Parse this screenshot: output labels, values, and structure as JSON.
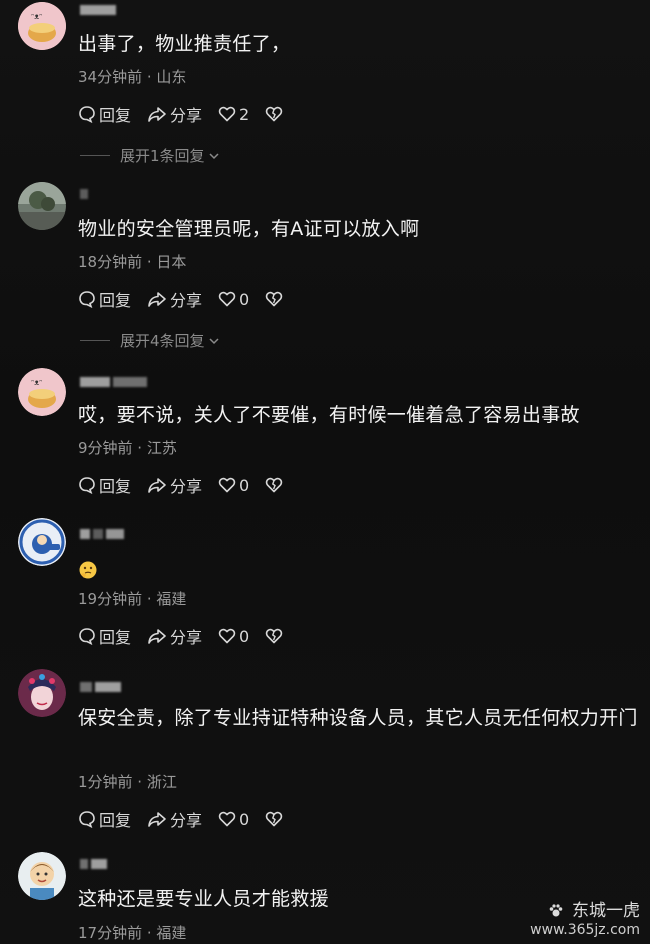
{
  "comments": [
    {
      "text": "出事了，物业推责任了，",
      "meta": "34分钟前 · 山东",
      "reply_label": "回复",
      "share_label": "分享",
      "like_count": "2",
      "expand_label": "展开1条回复"
    },
    {
      "text": "物业的安全管理员呢，有A证可以放入啊",
      "meta": "18分钟前 · 日本",
      "reply_label": "回复",
      "share_label": "分享",
      "like_count": "0",
      "expand_label": "展开4条回复"
    },
    {
      "text": "哎，要不说，关人了不要催，有时候一催着急了容易出事故",
      "meta": "9分钟前 · 江苏",
      "reply_label": "回复",
      "share_label": "分享",
      "like_count": "0"
    },
    {
      "text": "",
      "emoji": "thinking-face-emoji",
      "meta": "19分钟前 · 福建",
      "reply_label": "回复",
      "share_label": "分享",
      "like_count": "0"
    },
    {
      "text": "保安全责，除了专业持证特种设备人员，其它人员无任何权力开门",
      "meta": "1分钟前 · 浙江",
      "reply_label": "回复",
      "share_label": "分享",
      "like_count": "0"
    },
    {
      "text": "这种还是要专业人员才能救援",
      "meta": "17分钟前 · 福建"
    }
  ],
  "icons": {
    "reply": "reply-bubble-icon",
    "share": "share-arrow-icon",
    "like": "heart-icon",
    "dislike": "broken-heart-icon",
    "expand": "chevron-down-icon"
  },
  "watermark": {
    "name": "东城一虎",
    "url": "www.365jz.com"
  },
  "colors": {
    "background": "#111111",
    "text": "#f3f3f3",
    "meta": "#9a9a9a"
  }
}
